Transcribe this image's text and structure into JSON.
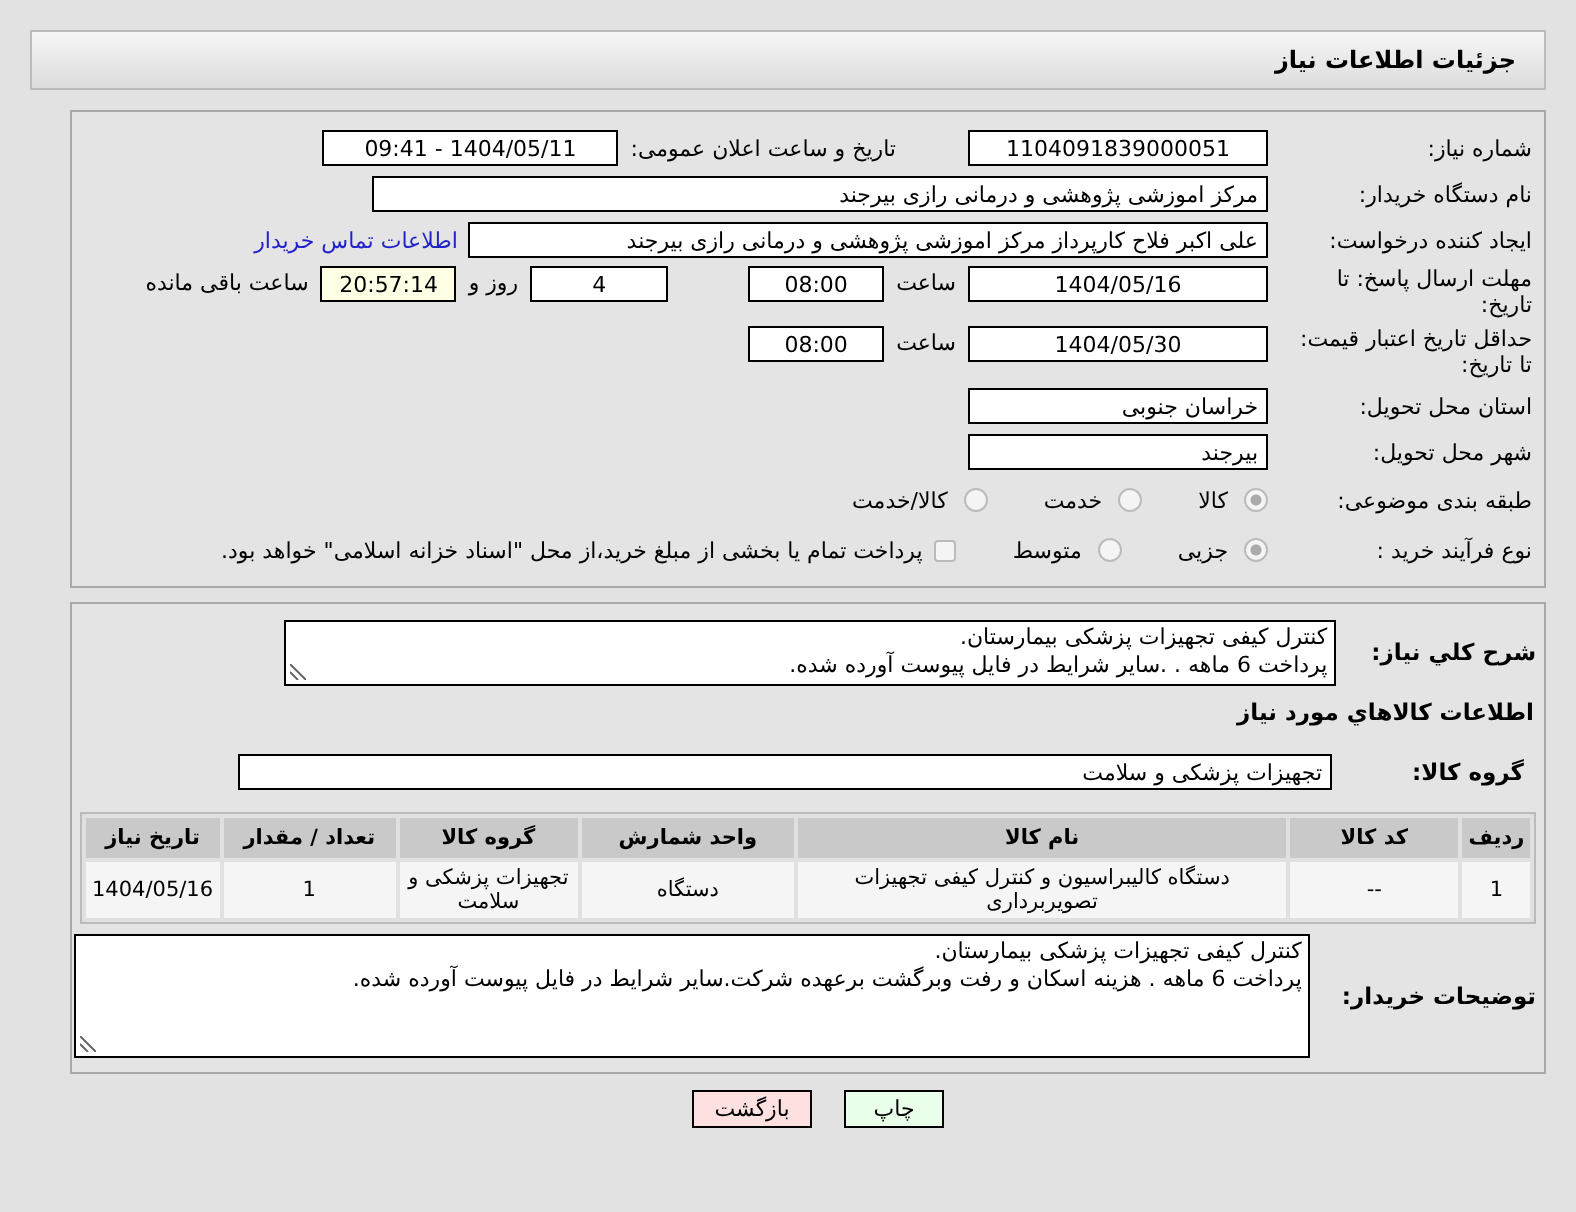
{
  "header": {
    "title": "جزئیات اطلاعات نیاز"
  },
  "need_number": {
    "label": "شماره نیاز:",
    "value": "1104091839000051"
  },
  "announce": {
    "label": "تاریخ و ساعت اعلان عمومی:",
    "value": "1404/05/11 - 09:41"
  },
  "buyer_org": {
    "label": "نام دستگاه خریدار:",
    "value": "مرکز اموزشی پژوهشی و درمانی رازی بیرجند"
  },
  "requester": {
    "label": "ایجاد کننده درخواست:",
    "value": "علی اکبر فلاح کارپرداز مرکز اموزشی پژوهشی و درمانی رازی بیرجند",
    "link": "اطلاعات تماس خریدار"
  },
  "reply_deadline": {
    "label": "مهلت ارسال پاسخ: تا تاریخ:",
    "date": "1404/05/16",
    "time_label": "ساعت",
    "time": "08:00",
    "days": "4",
    "days_label": "روز و",
    "remaining": "20:57:14",
    "remaining_label": "ساعت باقی مانده"
  },
  "price_validity": {
    "label": "حداقل تاریخ اعتبار قیمت: تا تاریخ:",
    "date": "1404/05/30",
    "time_label": "ساعت",
    "time": "08:00"
  },
  "province": {
    "label": "استان محل تحویل:",
    "value": "خراسان جنوبی"
  },
  "city": {
    "label": "شهر محل تحویل:",
    "value": "بیرجند"
  },
  "category": {
    "label": "طبقه بندی موضوعی:",
    "options": [
      {
        "label": "کالا",
        "selected": true
      },
      {
        "label": "خدمت",
        "selected": false
      },
      {
        "label": "کالا/خدمت",
        "selected": false
      }
    ]
  },
  "process": {
    "label": "نوع فرآیند خرید :",
    "options": [
      {
        "label": "جزیی",
        "selected": true
      },
      {
        "label": "متوسط",
        "selected": false
      }
    ],
    "treasury": {
      "checked": false,
      "text": "پرداخت تمام یا بخشی از مبلغ خرید،از محل \"اسناد خزانه اسلامی\" خواهد بود."
    }
  },
  "description": {
    "label": "شرح کلي نیاز:",
    "lines": [
      "کنترل کیفی تجهیزات پزشکی بیمارستان.",
      "پرداخت 6 ماهه . .سایر شرایط در فایل پیوست آورده شده."
    ]
  },
  "goods": {
    "title": "اطلاعات کالاهاي مورد نیاز",
    "group_label": "گروه کالا:",
    "group": "تجهیزات پزشکی و سلامت",
    "table": {
      "columns": [
        "ردیف",
        "کد کالا",
        "نام کالا",
        "واحد شمارش",
        "گروه کالا",
        "تعداد / مقدار",
        "تاریخ نیاز"
      ],
      "rows": [
        [
          "1",
          "--",
          "دستگاه کالیبراسیون و کنترل کیفی تجهیزات تصویربرداری",
          "دستگاه",
          "تجهیزات پزشکی و سلامت",
          "1",
          "1404/05/16"
        ]
      ]
    }
  },
  "buyer_notes": {
    "label": "توضیحات خریدار:",
    "lines": [
      "کنترل کیفی تجهیزات پزشکی بیمارستان.",
      "پرداخت 6 ماهه . هزینه اسکان و رفت وبرگشت برعهده شرکت.سایر شرایط در فایل پیوست آورده شده."
    ]
  },
  "buttons": [
    {
      "label": "چاپ",
      "kind": "print"
    },
    {
      "label": "بازگشت",
      "kind": "back"
    }
  ]
}
